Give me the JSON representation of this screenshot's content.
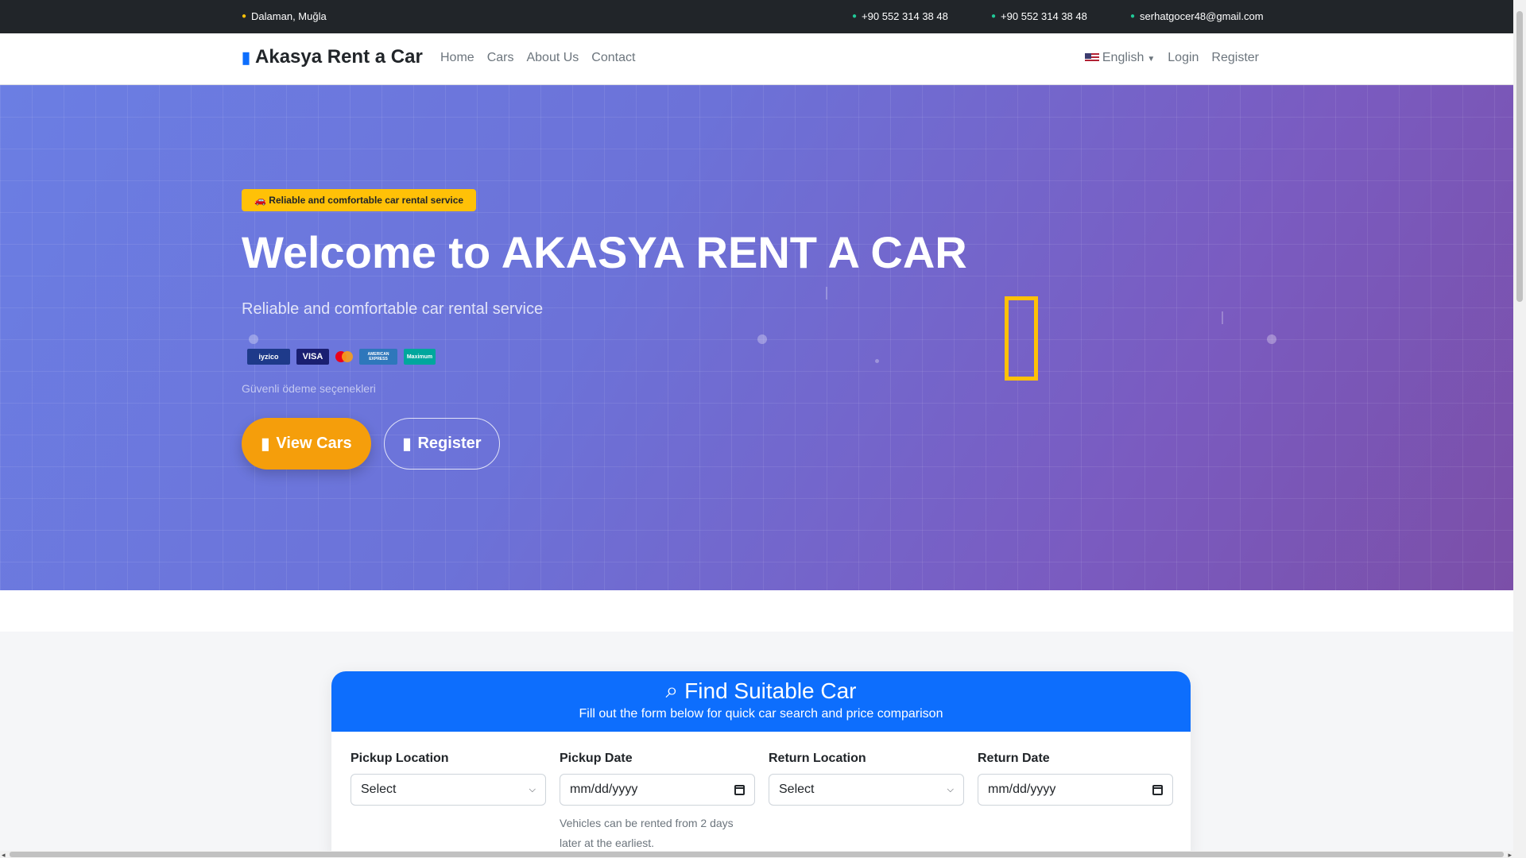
{
  "topbar": {
    "location": "Dalaman, Muğla",
    "phone1": "+90 552 314 38 48",
    "phone2": "+90 552 314 38 48",
    "email": "serhatgocer48@gmail.com"
  },
  "nav": {
    "brand": "Akasya Rent a Car",
    "links": [
      "Home",
      "Cars",
      "About Us",
      "Contact"
    ],
    "language": "English",
    "login": "Login",
    "register": "Register"
  },
  "hero": {
    "badge": "🚗 Reliable and comfortable car rental service",
    "title": "Welcome to AKASYA RENT A CAR",
    "subtitle": "Reliable and comfortable car rental service",
    "payment_logos": [
      "iyzico",
      "VISA",
      "AMERICAN EXPRESS",
      "Maximum"
    ],
    "payment_caption": "Güvenli ödeme seçenekleri",
    "view_cars": "View Cars",
    "register": "Register"
  },
  "search": {
    "title": "Find Suitable Car",
    "description": "Fill out the form below for quick car search and price comparison",
    "pickup_location_label": "Pickup Location",
    "pickup_location_value": "Select",
    "pickup_date_label": "Pickup Date",
    "pickup_date_value": "mm/dd/yyyy",
    "pickup_date_help": "Vehicles can be rented from 2 days later at the earliest.",
    "return_location_label": "Return Location",
    "return_location_value": "Select",
    "return_date_label": "Return Date",
    "return_date_value": "mm/dd/yyyy"
  },
  "colors": {
    "accent": "#0d6efd",
    "badge": "#ffc107",
    "cta": "#f59e0b",
    "hero_start": "#6b7ee3",
    "hero_end": "#7b4fa8"
  }
}
